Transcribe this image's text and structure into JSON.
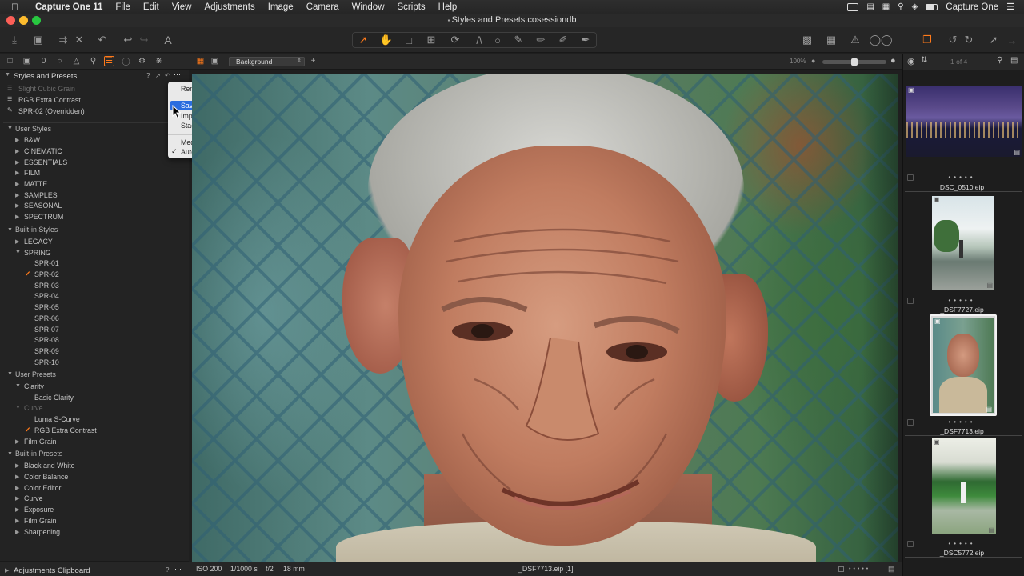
{
  "menubar": {
    "app_name": "Capture One 11",
    "items": [
      "File",
      "Edit",
      "View",
      "Adjustments",
      "Image",
      "Camera",
      "Window",
      "Scripts",
      "Help"
    ],
    "right_label": "Capture One"
  },
  "window": {
    "title": "Styles and Presets.cosessiondb"
  },
  "viewer_toolbar": {
    "variant_select": "Background",
    "zoom": "100%"
  },
  "browser": {
    "counter": "1 of 4"
  },
  "left_panel": {
    "section_title": "Styles and Presets",
    "applied": [
      "Slight Cubic Grain",
      "RGB Extra Contrast",
      "SPR-02 (Overridden)"
    ],
    "user_styles_header": "User Styles",
    "user_styles": [
      "B&W",
      "CINEMATIC",
      "ESSENTIALS",
      "FILM",
      "MATTE",
      "SAMPLES",
      "SEASONAL",
      "SPECTRUM"
    ],
    "builtin_styles_header": "Built-in Styles",
    "legacy": "LEGACY",
    "spring": "SPRING",
    "spring_items": [
      "SPR-01",
      "SPR-02",
      "SPR-03",
      "SPR-04",
      "SPR-05",
      "SPR-06",
      "SPR-07",
      "SPR-08",
      "SPR-09",
      "SPR-10"
    ],
    "user_presets_header": "User Presets",
    "clarity": "Clarity",
    "basic_clarity": "Basic Clarity",
    "curve": "Curve",
    "luma_scurve": "Luma S-Curve",
    "rgb_extra_contrast": "RGB Extra Contrast",
    "film_grain": "Film Grain",
    "builtin_presets_header": "Built-in Presets",
    "builtin_presets": [
      "Black and White",
      "Color Balance",
      "Color Editor",
      "Curve",
      "Exposure",
      "Film Grain",
      "Sharpening"
    ],
    "clipboard": "Adjustments Clipboard",
    "help": "?"
  },
  "context_menu": {
    "items": [
      "Remove Tool",
      "Save User Style...",
      "Import Styles...",
      "Stack Styles",
      "Medium Size",
      "Auto Size"
    ]
  },
  "status": {
    "iso": "ISO 200",
    "shutter": "1/1000 s",
    "aperture": "f/2",
    "focal": "18 mm",
    "filename": "_DSF7713.eip [1]"
  },
  "thumbnails": [
    {
      "name": "DSC_0510.eip"
    },
    {
      "name": "_DSF7727.eip"
    },
    {
      "name": "_DSF7713.eip"
    },
    {
      "name": "_DSC5772.eip"
    }
  ],
  "colors": {
    "accent": "#ff7a1a",
    "selection": "#2a6ddf"
  }
}
